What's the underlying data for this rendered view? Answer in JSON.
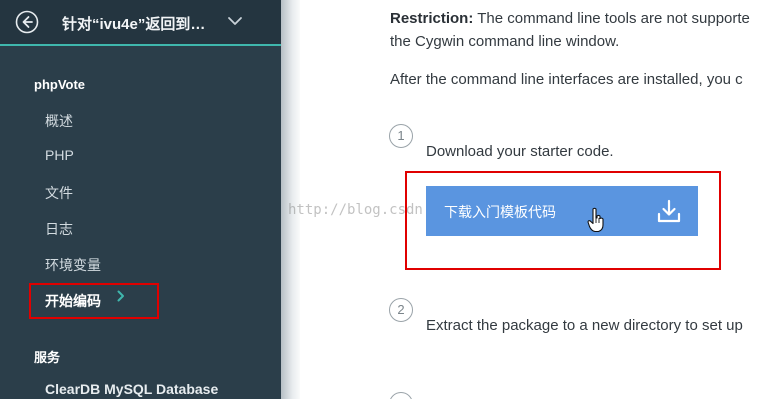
{
  "sidebar": {
    "header_title": "针对“ivu4e”返回到…",
    "app_section": "phpVote",
    "items": [
      {
        "label": "概述"
      },
      {
        "label": "PHP"
      },
      {
        "label": "文件"
      },
      {
        "label": "日志"
      },
      {
        "label": "环境变量"
      },
      {
        "label": "开始编码"
      }
    ],
    "services_section": "服务",
    "services": [
      {
        "label": "ClearDB MySQL Database"
      }
    ]
  },
  "main": {
    "restriction_bold": "Restriction:",
    "restriction_text": " The command line tools are not supporte",
    "restriction_line2": "the Cygwin command line window.",
    "after_text": "After the command line interfaces are installed, you c",
    "steps": [
      {
        "number": "1",
        "text": "Download your starter code."
      },
      {
        "number": "2",
        "text": "Extract the package to a new directory to set up"
      }
    ],
    "download_button": "下载入门模板代码"
  },
  "watermark": "http://blog.csdn",
  "icons": {
    "back": "back-arrow-circle-icon",
    "chevron": "chevron-down-icon",
    "download": "download-icon",
    "cursor": "hand-cursor-icon"
  },
  "colors": {
    "sidebar_bg": "#2b3e4a",
    "accent": "#3fb7ad",
    "button_bg": "#5a95e0",
    "highlight": "#e00000"
  }
}
